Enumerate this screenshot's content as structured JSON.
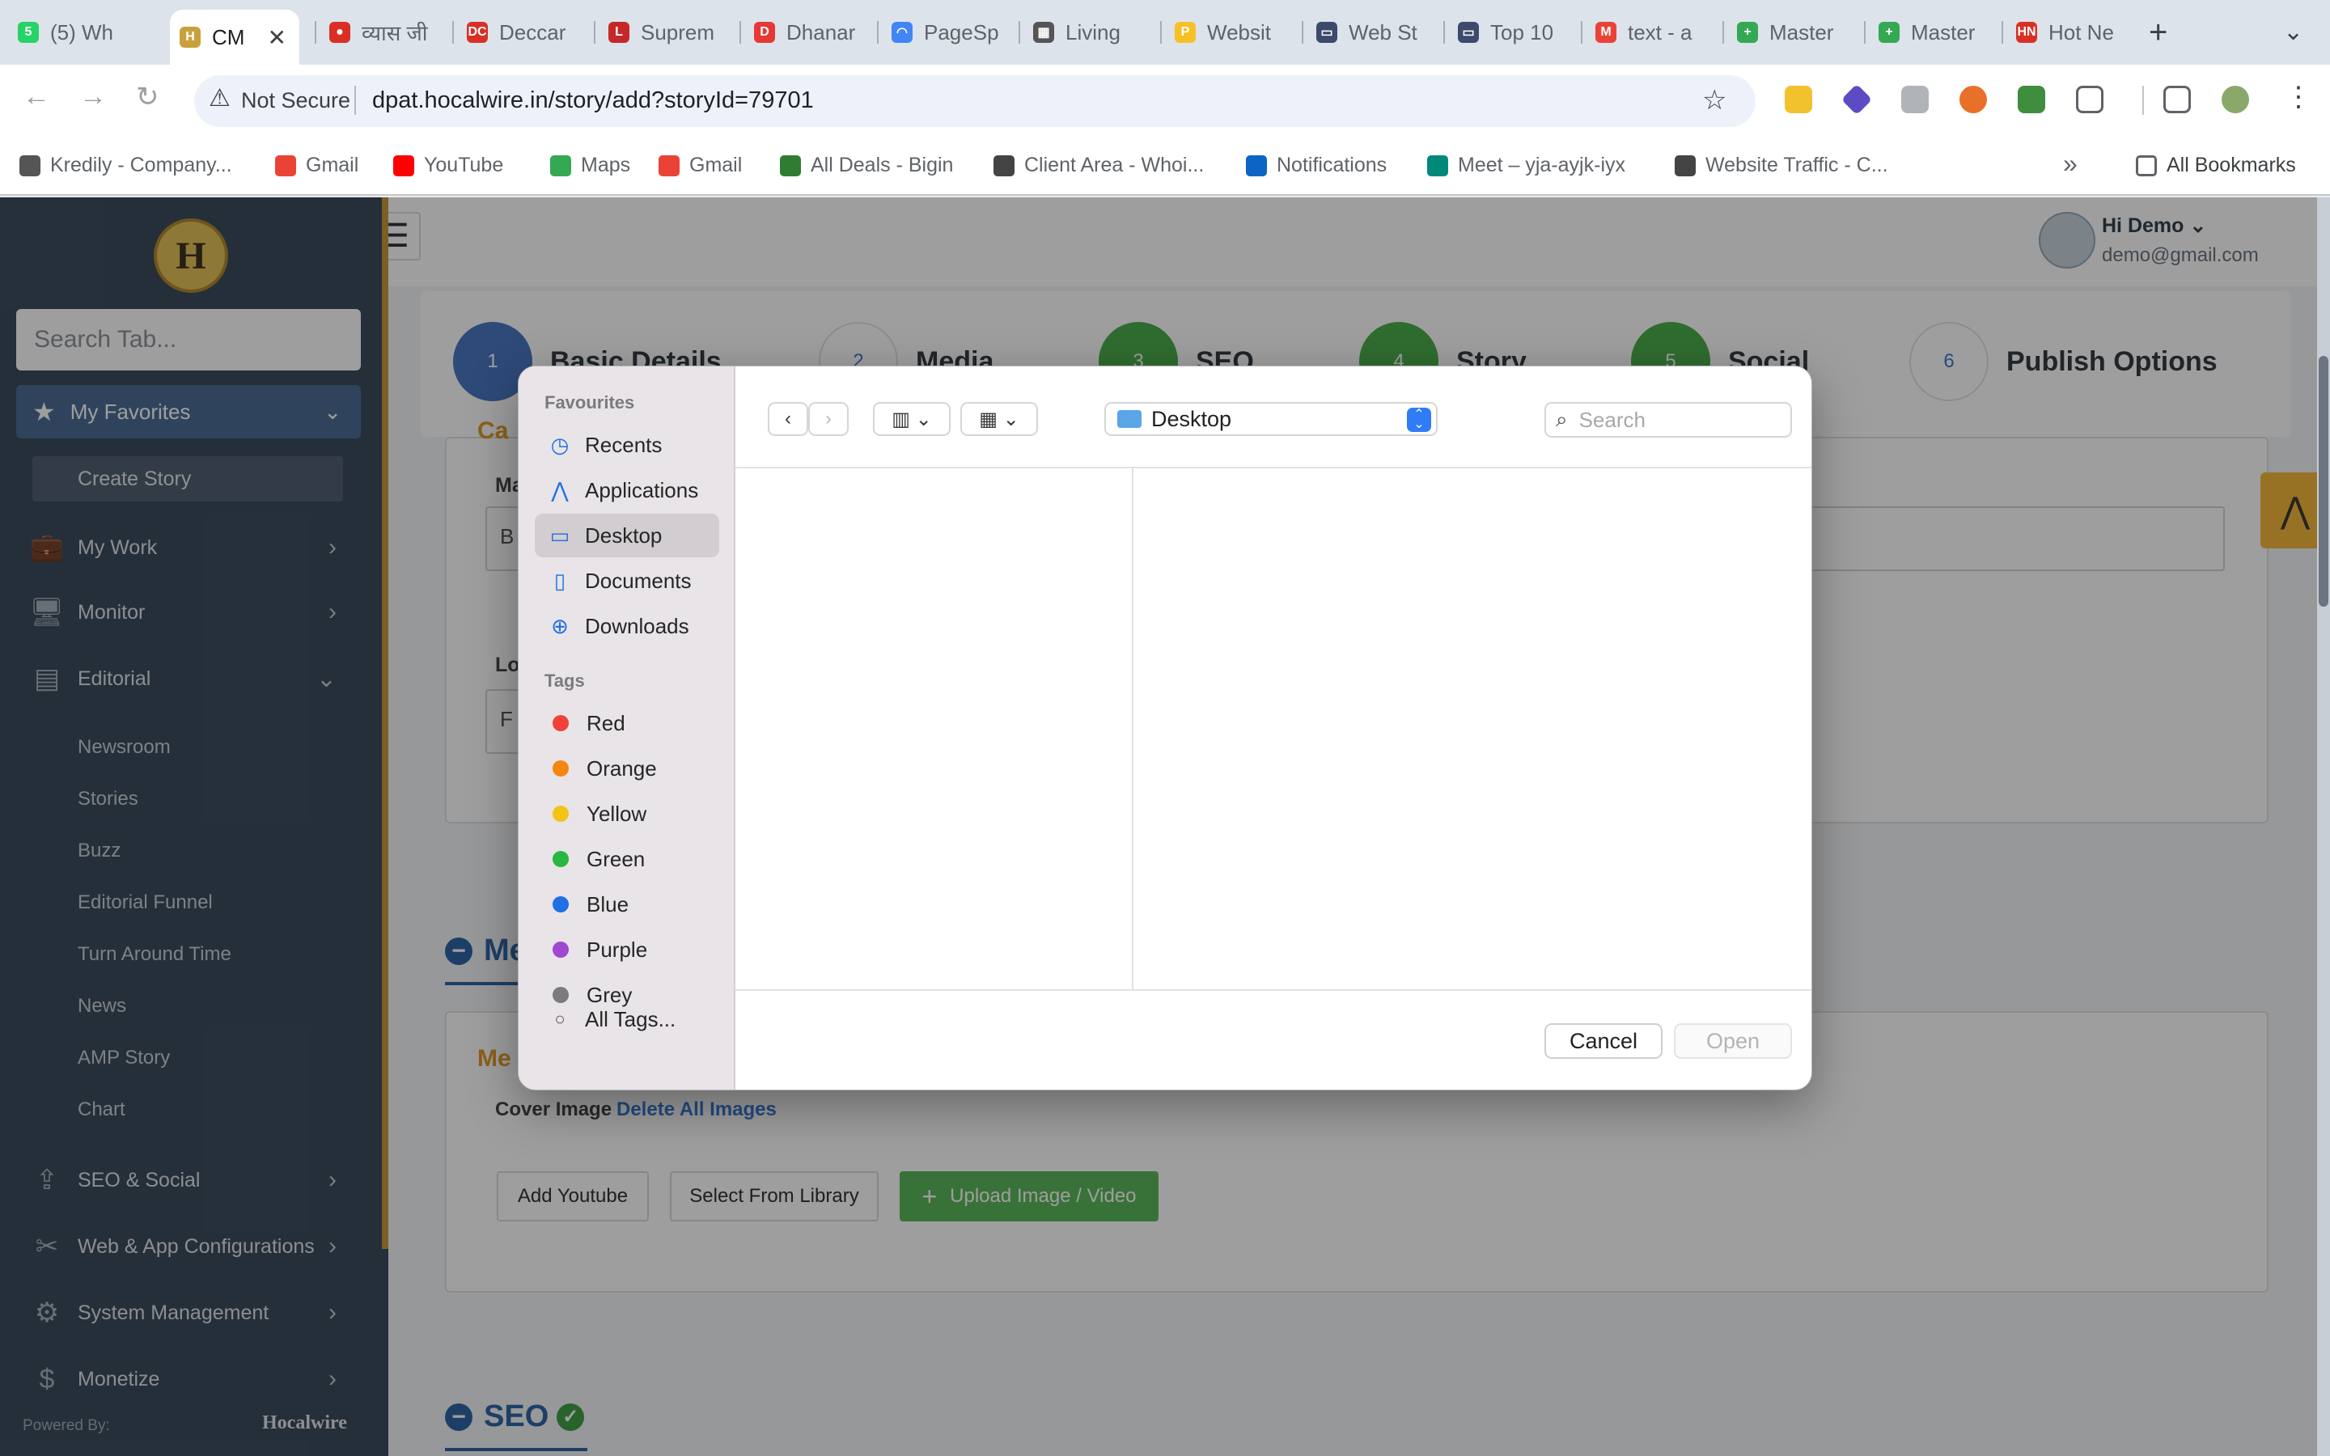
{
  "browser": {
    "tabs": [
      {
        "title": "(5) Wh",
        "color": "#25d366",
        "glyph": "5"
      },
      {
        "title": "CM",
        "color": "#c9a13c",
        "glyph": "H"
      },
      {
        "title": "व्यास जी",
        "color": "#d93025",
        "glyph": "●"
      },
      {
        "title": "Deccar",
        "color": "#d93025",
        "glyph": "DC"
      },
      {
        "title": "Suprem",
        "color": "#c62828",
        "glyph": "L"
      },
      {
        "title": "Dhanar",
        "color": "#e53935",
        "glyph": "D"
      },
      {
        "title": "PageSp",
        "color": "#4285f4",
        "glyph": "◠"
      },
      {
        "title": "Living",
        "color": "#555555",
        "glyph": "▦"
      },
      {
        "title": "Websit",
        "color": "#f6c026",
        "glyph": "P"
      },
      {
        "title": "Web St",
        "color": "#3c4a6b",
        "glyph": "▭"
      },
      {
        "title": "Top 10",
        "color": "#3c4a6b",
        "glyph": "▭"
      },
      {
        "title": "text - a",
        "color": "#ea4335",
        "glyph": "M"
      },
      {
        "title": "Master",
        "color": "#34a853",
        "glyph": "+"
      },
      {
        "title": "Master",
        "color": "#34a853",
        "glyph": "+"
      },
      {
        "title": "Hot Ne",
        "color": "#d93025",
        "glyph": "HN"
      }
    ],
    "close_glyph": "✕",
    "new_tab_glyph": "+",
    "tab_menu_glyph": "⌄",
    "not_secure": "Not Secure",
    "url": "dpat.hocalwire.in/story/add?storyId=79701",
    "bookmarks": [
      {
        "label": "Kredily - Company...",
        "color": "#555555"
      },
      {
        "label": "Gmail",
        "color": "#ea4335"
      },
      {
        "label": "YouTube",
        "color": "#ff0000"
      },
      {
        "label": "Maps",
        "color": "#34a853"
      },
      {
        "label": "Gmail",
        "color": "#ea4335"
      },
      {
        "label": "All Deals - Bigin",
        "color": "#2e7d32"
      },
      {
        "label": "Client Area - Whoi...",
        "color": "#444444"
      },
      {
        "label": "Notifications",
        "color": "#0a66c2"
      },
      {
        "label": "Meet – yja-ayjk-iyx",
        "color": "#00897b"
      },
      {
        "label": "Website Traffic - C...",
        "color": "#444444"
      }
    ],
    "more_bookmarks_glyph": "»",
    "all_bookmarks": "All Bookmarks"
  },
  "app": {
    "logo_letter": "H",
    "search_placeholder": "Search Tab...",
    "favorites_label": "My Favorites",
    "create_story": "Create Story",
    "menu": [
      {
        "label": "My Work",
        "icon": "briefcase-icon",
        "glyph": "💼"
      },
      {
        "label": "Monitor",
        "icon": "monitor-icon",
        "glyph": "🖥"
      },
      {
        "label": "Editorial",
        "icon": "editorial-icon",
        "glyph": "▤"
      }
    ],
    "editorial_sub": [
      "Newsroom",
      "Stories",
      "Buzz",
      "Editorial Funnel",
      "Turn Around Time",
      "News",
      "AMP Story",
      "Chart"
    ],
    "menu_bottom": [
      {
        "label": "SEO & Social",
        "icon": "share-icon",
        "glyph": "⇪"
      },
      {
        "label": "Web & App Configurations",
        "icon": "tools-icon",
        "glyph": "✂"
      },
      {
        "label": "System Management",
        "icon": "gears-icon",
        "glyph": "⚙"
      },
      {
        "label": "Monetize",
        "icon": "money-icon",
        "glyph": "$"
      }
    ],
    "powered_by": "Powered By:",
    "powered_brand": "Hocalwire",
    "user_name": "Hi Demo",
    "user_email": "demo@gmail.com",
    "steps": [
      {
        "num": "1",
        "label": "Basic Details",
        "color": "#4a78c2"
      },
      {
        "num": "2",
        "label": "Media",
        "color": "#ffffff"
      },
      {
        "num": "3",
        "label": "SEO",
        "color": "#4cae4c"
      },
      {
        "num": "4",
        "label": "Story",
        "color": "#4cae4c"
      },
      {
        "num": "5",
        "label": "Social",
        "color": "#4cae4c"
      },
      {
        "num": "6",
        "label": "Publish Options",
        "color": "#ffffff"
      }
    ],
    "partial_heading_1": "Ca",
    "field_ma": "Ma",
    "field_ma_value": "B",
    "field_lo": "Lo",
    "field_lo_value": "F",
    "media_heading": "Me",
    "media_sub_heading": "Me",
    "cover_image": "Cover Image",
    "delete_all_images": "Delete All Images",
    "add_youtube": "Add Youtube",
    "select_from_library": "Select From Library",
    "upload": "Upload Image / Video",
    "seo_heading": "SEO"
  },
  "dialog": {
    "favourites_heading": "Favourites",
    "favourites": [
      {
        "label": "Recents",
        "glyph": "◷",
        "name": "recents"
      },
      {
        "label": "Applications",
        "glyph": "⋀",
        "name": "applications"
      },
      {
        "label": "Desktop",
        "glyph": "▭",
        "name": "desktop"
      },
      {
        "label": "Documents",
        "glyph": "▯",
        "name": "documents"
      },
      {
        "label": "Downloads",
        "glyph": "⊕",
        "name": "downloads"
      }
    ],
    "tags_heading": "Tags",
    "tags": [
      {
        "label": "Red",
        "color": "#f2403a"
      },
      {
        "label": "Orange",
        "color": "#f5860f"
      },
      {
        "label": "Yellow",
        "color": "#f3c415"
      },
      {
        "label": "Green",
        "color": "#28b83f"
      },
      {
        "label": "Blue",
        "color": "#1f6fe5"
      },
      {
        "label": "Purple",
        "color": "#a046d0"
      },
      {
        "label": "Grey",
        "color": "#7b7b7b"
      }
    ],
    "all_tags": "All Tags...",
    "location": "Desktop",
    "search_placeholder": "Search",
    "cancel": "Cancel",
    "open": "Open"
  }
}
